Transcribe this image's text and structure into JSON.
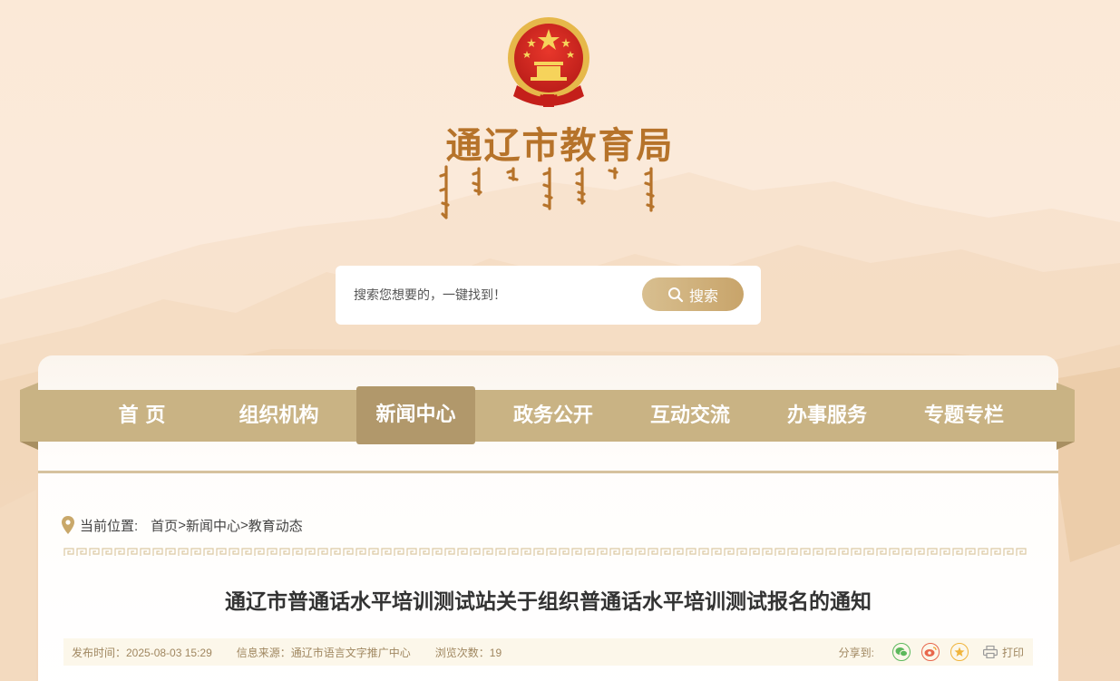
{
  "header": {
    "site_title": "通辽市教育局",
    "mongolian_title": "ᠲᠥᠩᠯᠢᠶᠣ ᠬᠣᠲᠠ ᠶᠢᠨ ᠰᠤᠷᠭᠠᠨ ᠬᠥᠮᠦᠵᠢᠯ ᠦᠨ ᠲᠣᠪᠴᠢᠶᠠ",
    "emblem_icon": "national-emblem-icon"
  },
  "search": {
    "placeholder": "搜索您想要的，一键找到！",
    "button_label": "搜索"
  },
  "nav": {
    "items": [
      {
        "label": "首 页"
      },
      {
        "label": "组织机构"
      },
      {
        "label": "新闻中心"
      },
      {
        "label": "政务公开"
      },
      {
        "label": "互动交流"
      },
      {
        "label": "办事服务"
      },
      {
        "label": "专题专栏"
      }
    ],
    "active_index": 2
  },
  "breadcrumb": {
    "label": "当前位置:",
    "items": [
      "首页",
      "新闻中心",
      "教育动态"
    ],
    "separator": ">"
  },
  "article": {
    "title": "通辽市普通话水平培训测试站关于组织普通话水平培训测试报名的通知",
    "publish_time": "发布时间：2025-08-03 15:29",
    "source": "信息来源：通辽市语言文字推广中心",
    "views": "浏览次数：19",
    "share_label": "分享到:",
    "print_label": "打印"
  },
  "colors": {
    "nav_bg": "#c9b384",
    "nav_active": "#b1986b",
    "title_gold": "#b6732a",
    "meta_text": "#a08760"
  }
}
